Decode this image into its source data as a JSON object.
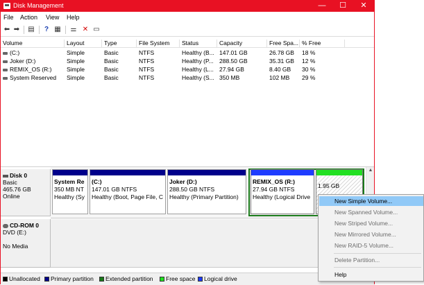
{
  "window": {
    "title": "Disk Management",
    "minimize": "—",
    "maximize": "☐",
    "close": "✕"
  },
  "menu": {
    "file": "File",
    "action": "Action",
    "view": "View",
    "help": "Help"
  },
  "volume_table": {
    "columns": [
      "Volume",
      "Layout",
      "Type",
      "File System",
      "Status",
      "Capacity",
      "Free Spa...",
      "% Free"
    ],
    "rows": [
      [
        "(C:)",
        "Simple",
        "Basic",
        "NTFS",
        "Healthy (B...",
        "147.01 GB",
        "26.78 GB",
        "18 %"
      ],
      [
        "Joker (D:)",
        "Simple",
        "Basic",
        "NTFS",
        "Healthy (P...",
        "288.50 GB",
        "35.31 GB",
        "12 %"
      ],
      [
        "REMIX_OS (R:)",
        "Simple",
        "Basic",
        "NTFS",
        "Healthy (L...",
        "27.94 GB",
        "8.40 GB",
        "30 %"
      ],
      [
        "System Reserved",
        "Simple",
        "Basic",
        "NTFS",
        "Healthy (S...",
        "350 MB",
        "102 MB",
        "29 %"
      ]
    ]
  },
  "disk0": {
    "name": "Disk 0",
    "type": "Basic",
    "size": "465.76 GB",
    "status": "Online",
    "partitions": [
      {
        "title": "System Re",
        "line1": "350 MB NT",
        "line2": "Healthy (Sy"
      },
      {
        "title": "(C:)",
        "line1": "147.01 GB NTFS",
        "line2": "Healthy (Boot, Page File, C"
      },
      {
        "title": "Joker  (D:)",
        "line1": "288.50 GB NTFS",
        "line2": "Healthy (Primary Partition)"
      },
      {
        "title": "REMIX_OS  (R:)",
        "line1": "27.94 GB NTFS",
        "line2": "Healthy (Logical Drive"
      },
      {
        "title": "",
        "line1": "1.95 GB",
        "line2": ""
      }
    ]
  },
  "cdrom": {
    "name": "CD-ROM 0",
    "type": "DVD (E:)",
    "status": "No Media"
  },
  "legend": [
    "Unallocated",
    "Primary partition",
    "Extended partition",
    "Free space",
    "Logical drive"
  ],
  "colors": {
    "unallocated": "#000000",
    "primary": "#00008b",
    "extended": "#1a7a1a",
    "free": "#22e022",
    "logical": "#1e3cff",
    "accent": "#e81123",
    "highlight": "#91c9f7"
  },
  "context_menu": {
    "items": [
      {
        "label": "New Simple Volume...",
        "enabled": true
      },
      {
        "label": "New Spanned Volume...",
        "enabled": false
      },
      {
        "label": "New Striped Volume...",
        "enabled": false
      },
      {
        "label": "New Mirrored Volume...",
        "enabled": false
      },
      {
        "label": "New RAID-5 Volume...",
        "enabled": false
      },
      {
        "label": "Delete Partition...",
        "enabled": false
      },
      {
        "label": "Help",
        "enabled": true
      }
    ]
  }
}
